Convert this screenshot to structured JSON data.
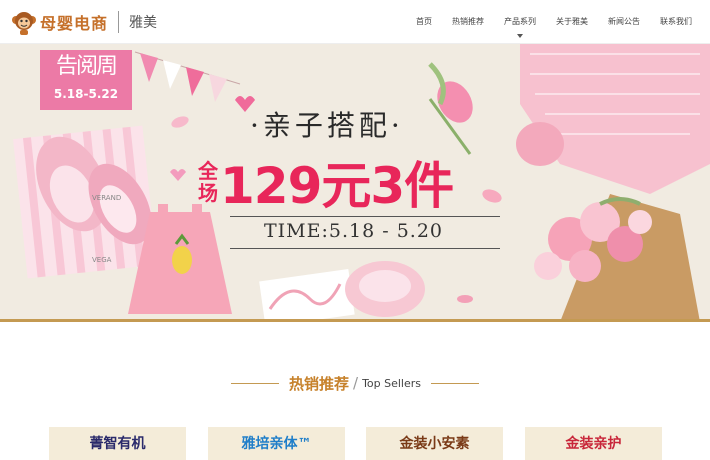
{
  "header": {
    "logo_text": "母婴电商",
    "logo_sub": "雅美",
    "nav": [
      {
        "label": "首页"
      },
      {
        "label": "热销推荐"
      },
      {
        "label": "产品系列"
      },
      {
        "label": "关于雅美"
      },
      {
        "label": "新闻公告"
      },
      {
        "label": "联系我们"
      }
    ]
  },
  "banner": {
    "stamp_title": "告阅周",
    "stamp_date": "5.18-5.22",
    "slogan1": "·亲子搭配·",
    "slogan2_prefix": "全场",
    "slogan2": "129元3件",
    "time": "TIME:5.18 - 5.20",
    "product_tags": [
      "VEGA",
      "VERAND"
    ]
  },
  "section": {
    "title_cn": "热销推荐",
    "slash": "/",
    "title_en": "Top Sellers"
  },
  "cards": [
    {
      "label": "菁智有机",
      "color": "#2a2a6b"
    },
    {
      "label": "雅培亲体™",
      "color": "#1f7ec9"
    },
    {
      "label": "金装小安素",
      "color": "#7a3a17"
    },
    {
      "label": "金装亲护",
      "color": "#c8263a"
    }
  ],
  "colors": {
    "accent": "#c7822c",
    "pink": "#e8265a",
    "gold_line": "#c49a52"
  }
}
